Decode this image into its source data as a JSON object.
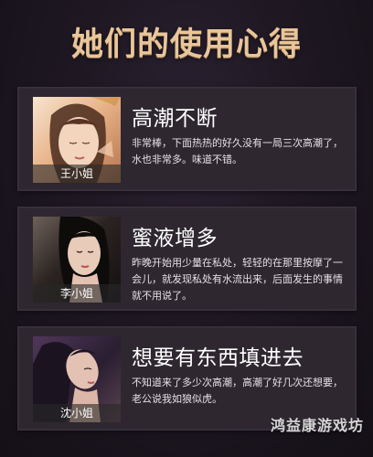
{
  "page": {
    "title": "她们的使用心得"
  },
  "reviews": [
    {
      "name": "王小姐",
      "title": "高潮不断",
      "text": "非常棒，下面热热的好久没有一局三次高潮了，水也非常多。味道不错。"
    },
    {
      "name": "李小姐",
      "title": "蜜液增多",
      "text": "昨晚开始用少量在私处，轻轻的在那里按摩了一会儿，就发现私处有水流出来，后面发生的事情就不用说了。"
    },
    {
      "name": "沈小姐",
      "title": "想要有东西填进去",
      "text": "不知道来了多少次高潮，高潮了好几次还想要，老公说我如狼似虎。"
    }
  ],
  "watermark": {
    "text": "鸿益康游戏坊"
  }
}
